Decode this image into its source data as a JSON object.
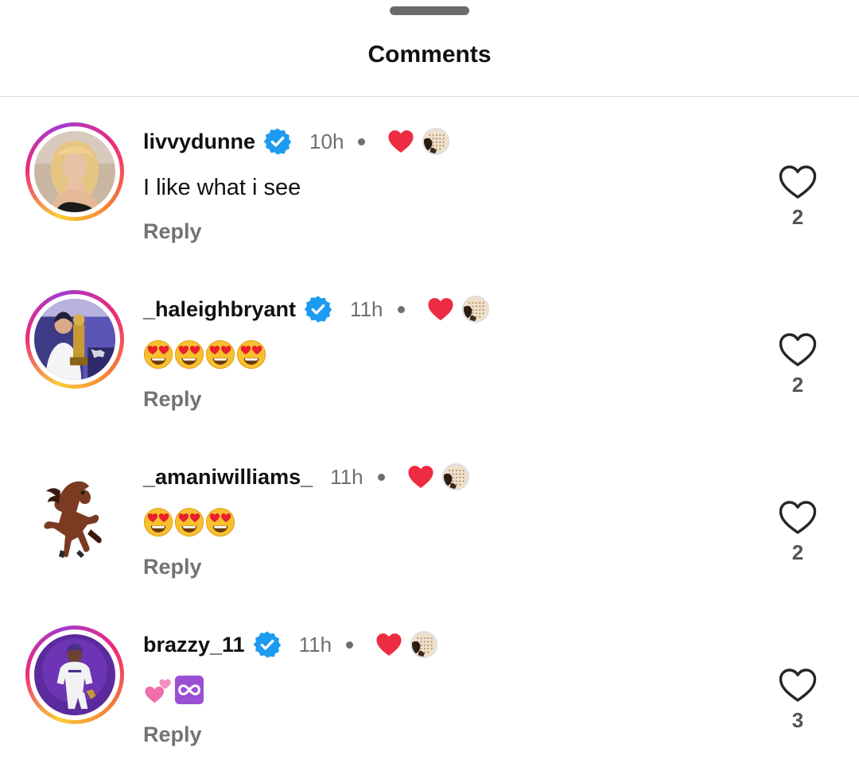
{
  "header": {
    "title": "Comments"
  },
  "colors": {
    "verified": "#1d9bf0",
    "heart": "#ed4956",
    "meta": "#6f6f6f"
  },
  "comments": [
    {
      "username": "livvydunne",
      "verified": true,
      "time": "10h",
      "text": "I like what i see",
      "emojis": [],
      "reply_label": "Reply",
      "likes": "2",
      "creator_liked": true
    },
    {
      "username": "_haleighbryant",
      "verified": true,
      "time": "11h",
      "text": "",
      "emojis": [
        "heart-eyes-emoji",
        "heart-eyes-emoji",
        "heart-eyes-emoji",
        "heart-eyes-emoji"
      ],
      "reply_label": "Reply",
      "likes": "2",
      "creator_liked": true
    },
    {
      "username": "_amaniwilliams_",
      "verified": false,
      "time": "11h",
      "text": "",
      "emojis": [
        "heart-eyes-emoji",
        "heart-eyes-emoji",
        "heart-eyes-emoji"
      ],
      "reply_label": "Reply",
      "likes": "2",
      "creator_liked": true
    },
    {
      "username": "brazzy_11",
      "verified": true,
      "time": "11h",
      "text": "",
      "emojis": [
        "two-hearts-emoji",
        "infinity-emoji"
      ],
      "reply_label": "Reply",
      "likes": "3",
      "creator_liked": true
    }
  ]
}
